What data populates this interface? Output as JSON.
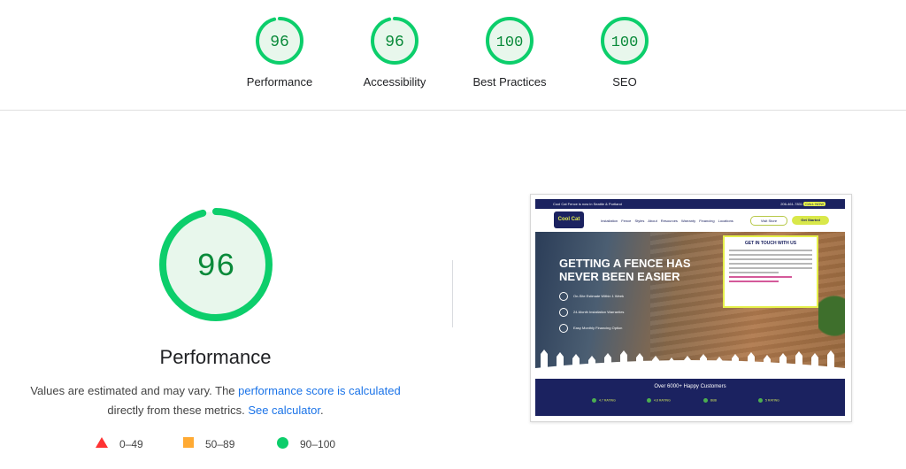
{
  "categories": [
    {
      "label": "Performance",
      "score": "96"
    },
    {
      "label": "Accessibility",
      "score": "96"
    },
    {
      "label": "Best Practices",
      "score": "100"
    },
    {
      "label": "SEO",
      "score": "100"
    }
  ],
  "main": {
    "score": "96",
    "title": "Performance",
    "note_prefix": "Values are estimated and may vary. The ",
    "note_link": "performance score is calculated",
    "note_middle": "directly from these metrics. ",
    "note_link2": "See calculator",
    "note_suffix": "."
  },
  "legend": [
    {
      "shape": "triangle",
      "color": "#ff3333",
      "label": "0–49"
    },
    {
      "shape": "square",
      "color": "#ffaa33",
      "label": "50–89"
    },
    {
      "shape": "circle",
      "color": "#0cce6b",
      "label": "90–100"
    }
  ],
  "colors": {
    "pass": "#0cce6b",
    "pass_fill": "#e8f7ec",
    "pass_text": "#0a8a3a"
  },
  "thumbnail": {
    "topbar_left": "Cool Cat Fence is now in Seattle & Portland",
    "topbar_phone": "206-461-7831",
    "topbar_cta": "CALL NOW",
    "logo": "Cool Cat",
    "menu": "Installation  Fence Styles  About  Resources  Warranty  Financing  Locations",
    "pill_one": "Visit Store",
    "pill_two": "Get Started",
    "headline": "GETTING A FENCE HAS NEVER BEEN EASIER",
    "bullets": [
      "On-Site Estimate Within 1 Week",
      "24-Month Installation Warranties",
      "Easy Monthly Financing Option"
    ],
    "card_title": "GET IN TOUCH WITH US",
    "footer_title": "Over 6000+ Happy Customers",
    "stats": [
      "4.7 RATING",
      "4.8 RATING",
      "BBB",
      "5 RATING"
    ]
  }
}
